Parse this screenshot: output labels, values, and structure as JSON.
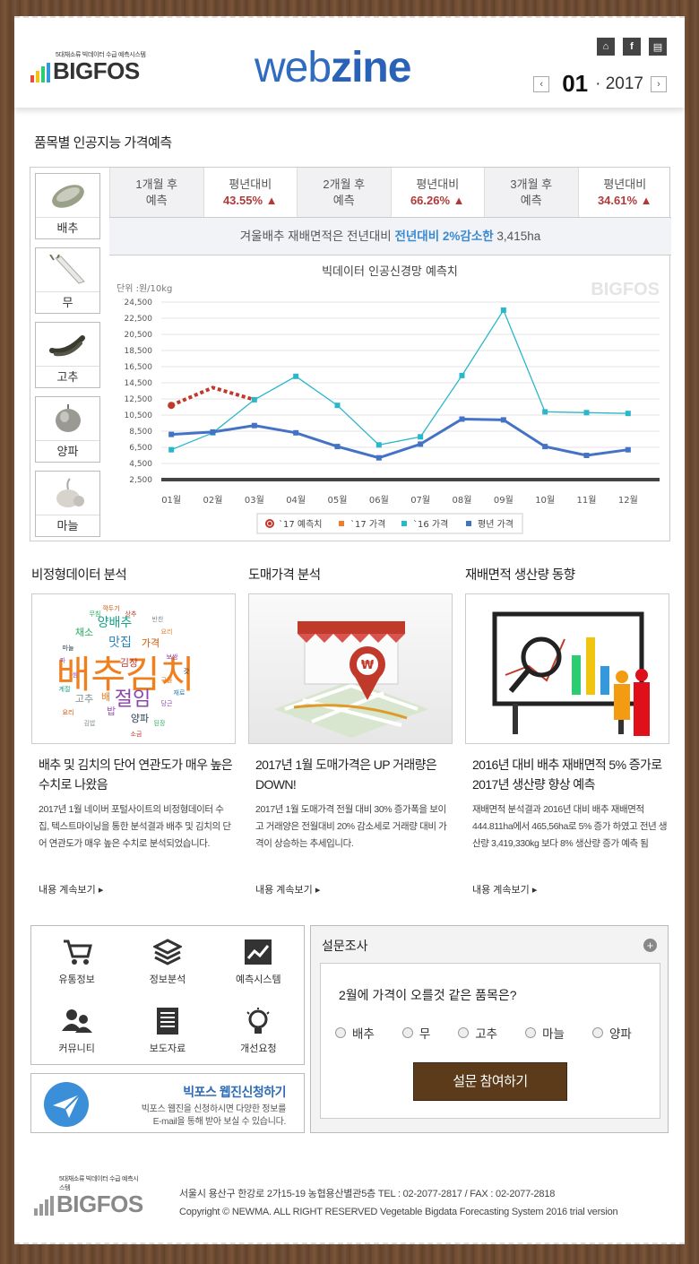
{
  "header": {
    "logo_tagline": "5대채소류 빅데이터 수급 예측시스템",
    "logo_word": "BIGFOS",
    "title_light": "web",
    "title_bold": "zine",
    "month": "01",
    "year_prefix": "·",
    "year": "2017",
    "icon_home": "home-icon",
    "icon_fb": "facebook-icon",
    "icon_doc": "document-icon"
  },
  "section_forecast": {
    "title": "품목별 인공지능 가격예측",
    "items": [
      "배추",
      "무",
      "고추",
      "양파",
      "마늘"
    ],
    "forecast": [
      {
        "label1": "1개월 후",
        "label2": "예측"
      },
      {
        "label1": "평년대비",
        "value": "43.55%"
      },
      {
        "label1": "2개월 후",
        "label2": "예측"
      },
      {
        "label1": "평년대비",
        "value": "66.26%"
      },
      {
        "label1": "3개월 후",
        "label2": "예측"
      },
      {
        "label1": "평년대비",
        "value": "34.61%"
      }
    ],
    "note_pre": "겨울배추 재배면적은 전년대비 ",
    "note_hl": "전년대비 2%감소한",
    "note_post": " 3,415ha"
  },
  "chart_data": {
    "type": "line",
    "title": "빅데이터 인공신경망 예측치",
    "unit_label": "단위 :원/10kg",
    "watermark": "BIGFOS",
    "categories": [
      "01월",
      "02월",
      "03월",
      "04월",
      "05월",
      "06월",
      "07월",
      "08월",
      "09월",
      "10월",
      "11월",
      "12월"
    ],
    "ylim": [
      2500,
      24500
    ],
    "yticks": [
      2500,
      4500,
      6500,
      8500,
      10500,
      12500,
      14500,
      16500,
      18500,
      20500,
      22500,
      24500
    ],
    "series": [
      {
        "name": "`17 예측치",
        "color": "#c0392b",
        "values": [
          11700,
          13900,
          12400,
          null,
          null,
          null,
          null,
          null,
          null,
          null,
          null,
          null
        ]
      },
      {
        "name": "`17 가격",
        "color": "#ed7d31",
        "values": []
      },
      {
        "name": "`16 가격",
        "color": "#2ab7c9",
        "values": [
          6200,
          8300,
          12400,
          15300,
          11700,
          6800,
          7800,
          15400,
          23500,
          10900,
          10800,
          10700
        ]
      },
      {
        "name": "평년 가격",
        "color": "#4472c4",
        "values": [
          8100,
          8400,
          9200,
          8300,
          6600,
          5200,
          6900,
          10000,
          9900,
          6600,
          5500,
          6200
        ]
      }
    ]
  },
  "news": [
    {
      "title": "비정형데이터 분석",
      "headline": "배추 및 김치의 단어 연관도가 매우 높은 수치로 나왔음",
      "desc": "2017년 1월 네이버 포털사이트의 비정형데이터 수집, 텍스트마이닝을 통한 분석결과 배추 및 김치의 단어 연관도가 매우 높은 수치로 분석되었습니다.",
      "more": "내용 계속보기"
    },
    {
      "title": "도매가격 분석",
      "headline": "2017년 1월 도매가격은 UP 거래량은 DOWN!",
      "desc": "2017년 1월 도매가격 전월 대비 30% 증가폭을 보이고 거래양은 전월대비 20% 감소세로 거래량 대비 가격이 상승하는 추세입니다.",
      "more": "내용 계속보기"
    },
    {
      "title": "재배면적 생산량 동향",
      "headline": "2016년 대비 배추 재배면적 5% 증가로 2017년 생산량 향상 예측",
      "desc": "재배면적 분석결과 2016년 대비 배추 재배면적 444.811ha에서 465,56ha로 5% 증가 하였고 전년 생산량 3,419,330kg 보다 8% 생산량 증가 예측 됨",
      "more": "내용 계속보기"
    }
  ],
  "wordcloud": {
    "big": "배추김치",
    "mid": [
      "절임",
      "맛집",
      "양배추",
      "가격",
      "김장",
      "채소",
      "고추",
      "배",
      "양파",
      "밥"
    ],
    "small": [
      "깍두기",
      "상추",
      "무침",
      "반찬",
      "요리",
      "마늘",
      "파",
      "당근",
      "재료",
      "계절",
      "요리",
      "소금",
      "된장",
      "김밥",
      "국물",
      "갓",
      "쌈",
      "보쌈"
    ]
  },
  "menu": [
    {
      "label": "유통정보",
      "icon": "cart-icon"
    },
    {
      "label": "정보분석",
      "icon": "layers-icon"
    },
    {
      "label": "예측시스템",
      "icon": "trend-chart-icon"
    },
    {
      "label": "커뮤니티",
      "icon": "users-icon"
    },
    {
      "label": "보도자료",
      "icon": "newspaper-icon"
    },
    {
      "label": "개선요청",
      "icon": "lightbulb-icon"
    }
  ],
  "apply": {
    "title": "빅포스 웹진신청하기",
    "line1": "빅포스 웹진을 신청하시면 다양한 정보를",
    "line2": "E-mail을 통해 받아 보실 수 있습니다."
  },
  "survey": {
    "title": "설문조사",
    "question": "2월에 가격이 오를것 같은 품목은?",
    "options": [
      "배추",
      "무",
      "고추",
      "마늘",
      "양파"
    ],
    "button": "설문 참여하기"
  },
  "footer": {
    "logo_tagline": "5대채소류 빅데이터 수급 예측시스템",
    "logo_word": "BIGFOS",
    "address": "서울시 용산구 한강로 2가15-19 농협용산별관5층 TEL : 02-2077-2817 / FAX : 02-2077-2818",
    "copyright": "Copyright © NEWMA. ALL RIGHT RESERVED Vegetable Bigdata Forecasting System 2016 trial version"
  }
}
